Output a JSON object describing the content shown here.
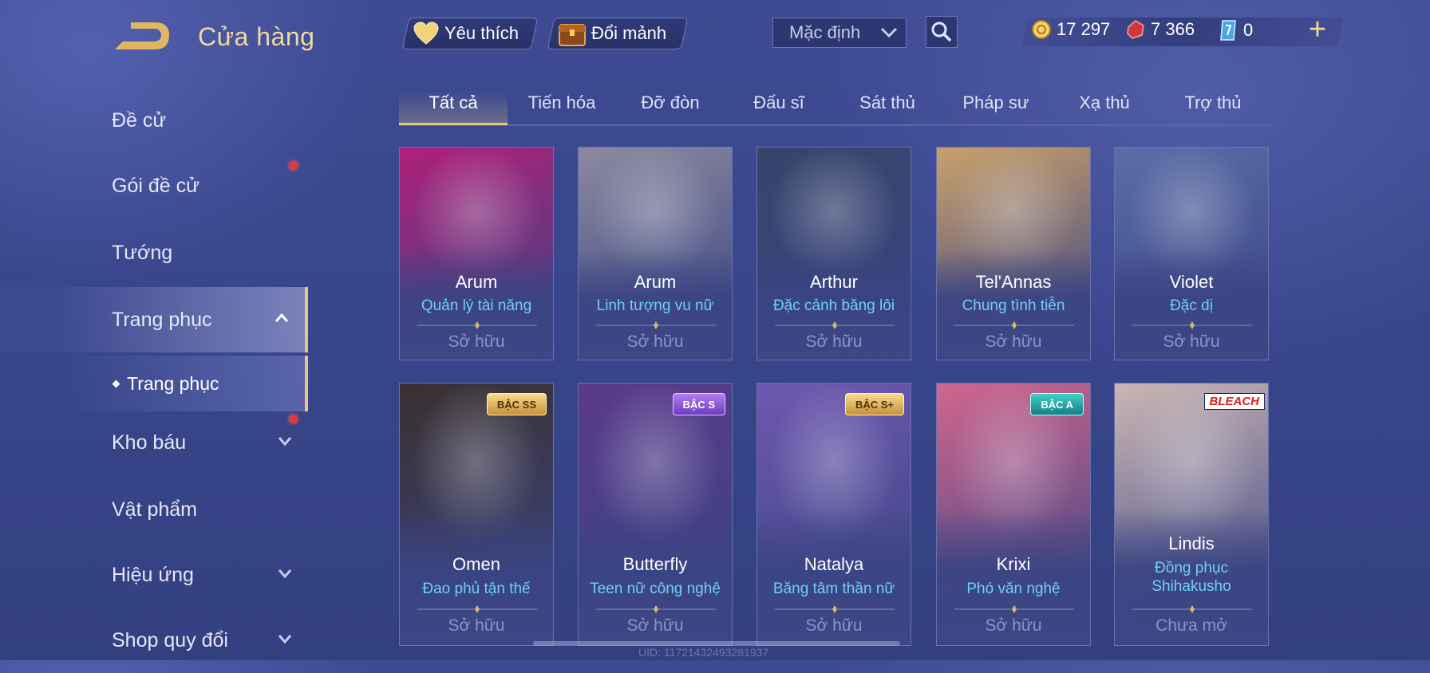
{
  "header": {
    "title": "Cửa hàng",
    "favorite_label": "Yêu thích",
    "exchange_label": "Đổi mảnh",
    "sort_value": "Mặc định",
    "currencies": {
      "gold": "17 297",
      "voucher": "7 366",
      "ticket": "0"
    }
  },
  "sidebar": {
    "items": [
      {
        "label": "Đề cử"
      },
      {
        "label": "Gói đề cử"
      },
      {
        "label": "Tướng"
      },
      {
        "label": "Trang phục"
      },
      {
        "label": "Kho báu"
      },
      {
        "label": "Vật phẩm"
      },
      {
        "label": "Hiệu ứng"
      },
      {
        "label": "Shop quy đổi"
      }
    ],
    "sub_item": "Trang phục"
  },
  "tabs": [
    "Tất cả",
    "Tiến hóa",
    "Đỡ đòn",
    "Đấu sĩ",
    "Sát thủ",
    "Pháp sư",
    "Xạ thủ",
    "Trợ thủ"
  ],
  "cards": [
    {
      "name": "Arum",
      "skin": "Quản lý tài năng",
      "status": "Sở hữu",
      "badge": "",
      "color": "#b0207a"
    },
    {
      "name": "Arum",
      "skin": "Linh tượng vu nữ",
      "status": "Sở hữu",
      "badge": "",
      "color": "#8c8aa0"
    },
    {
      "name": "Arthur",
      "skin": "Đặc cảnh băng lôi",
      "status": "Sở hữu",
      "badge": "",
      "color": "#36456a"
    },
    {
      "name": "Tel'Annas",
      "skin": "Chung tình tiễn",
      "status": "Sở hữu",
      "badge": "",
      "color": "#c9a06a"
    },
    {
      "name": "Violet",
      "skin": "Đặc dị",
      "status": "Sở hữu",
      "badge": "",
      "color": "#5a6ea8"
    },
    {
      "name": "Omen",
      "skin": "Đao phủ tận thế",
      "status": "Sở hữu",
      "badge": "BẬC SS",
      "color": "#3a3030"
    },
    {
      "name": "Butterfly",
      "skin": "Teen nữ công nghệ",
      "status": "Sở hữu",
      "badge": "BẬC S",
      "color": "#5a3a8a"
    },
    {
      "name": "Natalya",
      "skin": "Băng tâm thần nữ",
      "status": "Sở hữu",
      "badge": "BẬC S+",
      "color": "#6f58b0"
    },
    {
      "name": "Krixi",
      "skin": "Phó văn nghệ",
      "status": "Sở hữu",
      "badge": "BẬC A",
      "color": "#d0668e"
    },
    {
      "name": "Lindis",
      "skin": "Đồng phục Shihakusho",
      "status": "Chưa mở",
      "badge": "BLEACH",
      "color": "#cbb6b4"
    }
  ],
  "uid_text": "UID: 11721432493281937",
  "colors": {
    "accent_gold": "#e8c77c",
    "skin_text": "#6ed0f5",
    "background": "#39468c"
  }
}
